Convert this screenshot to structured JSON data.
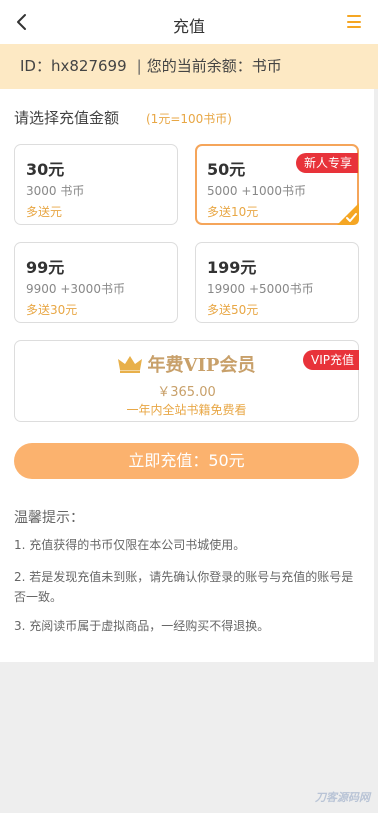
{
  "header": {
    "title": "充值"
  },
  "account": {
    "id_label": "ID：",
    "id_value": "hx827699",
    "separator": "|",
    "balance_label": "您的当前余额：书币"
  },
  "recharge": {
    "section_title": "请选择充值金额",
    "rate_note": "(1元=100书币)",
    "selected_index": 1,
    "options": [
      {
        "amount": "30元",
        "coins": "3000 书币",
        "gift": "多送元",
        "badge": ""
      },
      {
        "amount": "50元",
        "coins": "5000 +1000书币",
        "gift": "多送10元",
        "badge": "新人专享"
      },
      {
        "amount": "99元",
        "coins": "9900 +3000书币",
        "gift": "多送30元",
        "badge": ""
      },
      {
        "amount": "199元",
        "coins": "19900 +5000书币",
        "gift": "多送50元",
        "badge": ""
      }
    ]
  },
  "vip": {
    "title": "年费VIP会员",
    "price": "￥365.00",
    "description": "一年内全站书籍免费看",
    "badge": "VIP充值"
  },
  "submit": {
    "label": "立即充值：50元"
  },
  "tips": {
    "title": "温馨提示：",
    "items": [
      "1. 充值获得的书币仅限在本公司书城使用。",
      "2. 若是发现充值未到账，请先确认你登录的账号与充值的账号是否一致。",
      "3. 充阅读币属于虚拟商品，一经购买不得退换。"
    ]
  },
  "watermark": {
    "text": "刀客源码网"
  },
  "colors": {
    "accent": "#f5a623",
    "account_bg": "#fde9c4",
    "badge_red": "#e8333a",
    "button": "#fbb26e",
    "gold": "#c8a06a"
  }
}
